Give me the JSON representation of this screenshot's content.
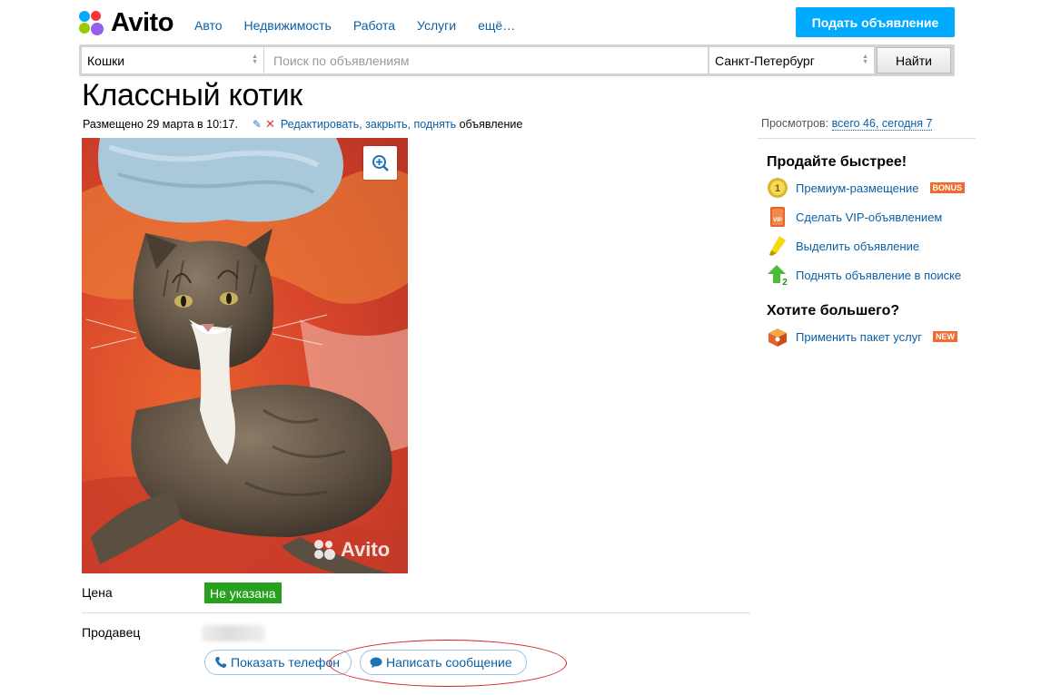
{
  "header": {
    "logo_text": "Avito",
    "nav": [
      "Авто",
      "Недвижимость",
      "Работа",
      "Услуги",
      "ещё…"
    ],
    "post_button": "Подать объявление"
  },
  "search": {
    "category": "Кошки",
    "placeholder": "Поиск по объявлениям",
    "city": "Санкт-Петербург",
    "submit": "Найти"
  },
  "listing": {
    "title": "Классный котик",
    "posted": "Размещено 29 марта в 10:17.",
    "edit_link": "Редактировать, закрыть, поднять",
    "edit_suffix": "объявление",
    "photo_watermark": "Avito",
    "price_label": "Цена",
    "price_value": "Не указана",
    "seller_label": "Продавец",
    "show_phone": "Показать телефон",
    "write_message": "Написать сообщение"
  },
  "views": {
    "label": "Просмотров:",
    "value": "всего 46, сегодня 7"
  },
  "sidebar": {
    "sell_faster_title": "Продайте быстрее!",
    "items": [
      {
        "label": "Премиум-размещение",
        "badge": "BONUS",
        "icon": "coin-icon"
      },
      {
        "label": "Сделать VIP-объявлением",
        "icon": "vip-icon"
      },
      {
        "label": "Выделить объявление",
        "icon": "highlighter-icon"
      },
      {
        "label": "Поднять объявление в поиске",
        "icon": "up-arrow-icon"
      }
    ],
    "want_more_title": "Хотите большего?",
    "package": {
      "label": "Применить пакет услуг",
      "badge": "NEW",
      "icon": "package-icon"
    }
  },
  "colors": {
    "accent": "#00aaff",
    "link": "#0a5fa6",
    "price_bg": "#27a01d",
    "badge": "#f26a2e",
    "annotation": "#d3232f"
  }
}
